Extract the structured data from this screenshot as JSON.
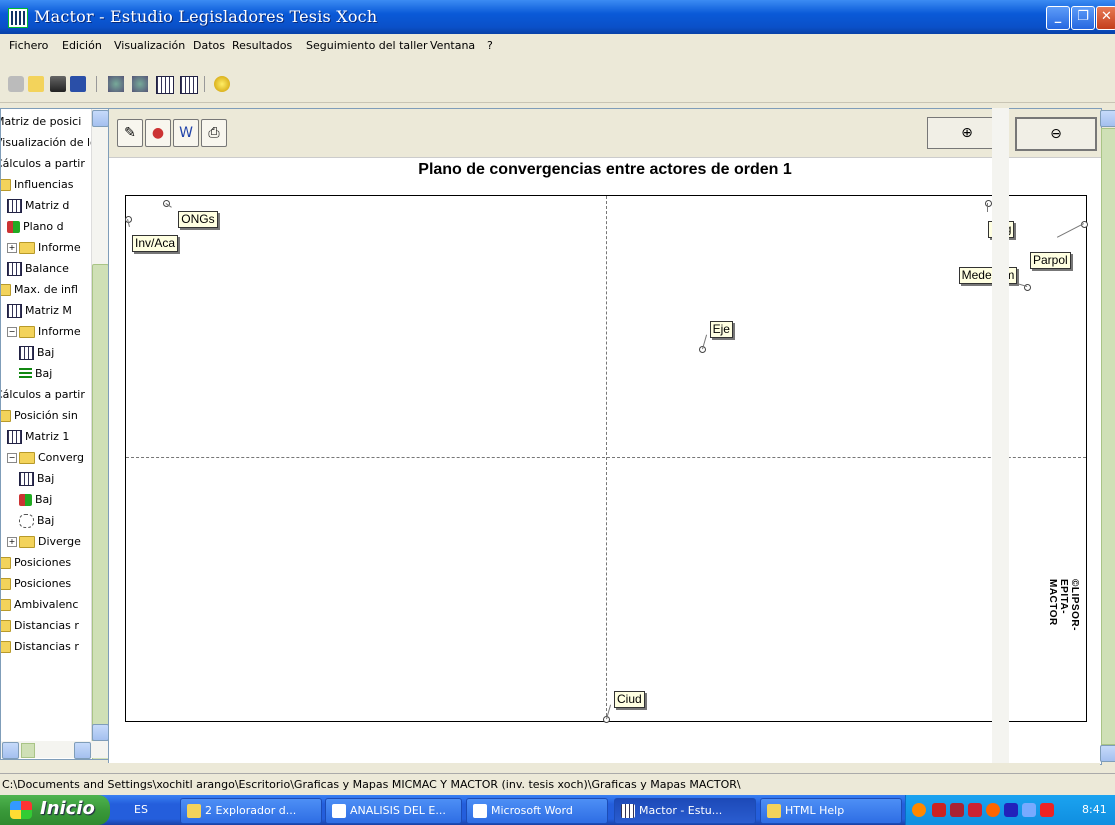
{
  "window": {
    "app": "Mactor",
    "separator": "-",
    "study": "Estudio Legisladores Tesis Xoch",
    "buttons": {
      "minimize": "_",
      "restore": "❐",
      "close": "✕"
    }
  },
  "menu": [
    "Fichero",
    "Edición",
    "Visualización",
    "Datos",
    "Resultados",
    "Seguimiento del taller",
    "Ventana",
    "?"
  ],
  "toolbar_icons": [
    "new-icon",
    "open-icon",
    "print-icon",
    "save-icon",
    "wizard-icon",
    "wizard2-icon",
    "table-icon",
    "table2-icon",
    "help-icon"
  ],
  "tree": {
    "items": [
      {
        "label": "Matriz de posici",
        "icon": "none",
        "indent": 0
      },
      {
        "label": "Visualización de los",
        "icon": "none",
        "indent": 0
      },
      {
        "label": "Cálculos a partir",
        "icon": "none",
        "indent": 0
      },
      {
        "label": "Influencias",
        "icon": "folder",
        "indent": 0
      },
      {
        "label": "Matriz d",
        "icon": "grid",
        "indent": 1
      },
      {
        "label": "Plano d",
        "icon": "plane",
        "indent": 1
      },
      {
        "label": "Informe",
        "icon": "folder",
        "indent": 1,
        "expander": "+"
      },
      {
        "label": "Balance",
        "icon": "grid",
        "indent": 1
      },
      {
        "label": "Max. de infl",
        "icon": "folder",
        "indent": 0
      },
      {
        "label": "Matriz M",
        "icon": "grid",
        "indent": 1
      },
      {
        "label": "Informe",
        "icon": "folder",
        "indent": 1,
        "expander": "−"
      },
      {
        "label": "Baj",
        "icon": "grid",
        "indent": 2
      },
      {
        "label": "Baj",
        "icon": "bars",
        "indent": 2
      },
      {
        "label": "Cálculos a partir",
        "icon": "none",
        "indent": 0
      },
      {
        "label": "Posición sin",
        "icon": "folder",
        "indent": 0
      },
      {
        "label": "Matriz 1",
        "icon": "grid",
        "indent": 1
      },
      {
        "label": "Converg",
        "icon": "folder",
        "indent": 1,
        "expander": "−"
      },
      {
        "label": "Baj",
        "icon": "grid",
        "indent": 2
      },
      {
        "label": "Baj",
        "icon": "plane",
        "indent": 2
      },
      {
        "label": "Baj",
        "icon": "net",
        "indent": 2
      },
      {
        "label": "Diverge",
        "icon": "folder",
        "indent": 1,
        "expander": "+"
      },
      {
        "label": "Posiciones",
        "icon": "folder",
        "indent": 0
      },
      {
        "label": "Posiciones",
        "icon": "folder",
        "indent": 0
      },
      {
        "label": "Ambivalenc",
        "icon": "folder",
        "indent": 0
      },
      {
        "label": "Distancias r",
        "icon": "folder",
        "indent": 0
      },
      {
        "label": "Distancias r",
        "icon": "folder",
        "indent": 0
      }
    ]
  },
  "main_toolbar": {
    "left_icons": [
      "copy-icon",
      "color-icon",
      "word-export-icon",
      "print-icon"
    ],
    "zoom_in": "⊕",
    "zoom_out": "⊖"
  },
  "chart_data": {
    "type": "scatter",
    "title": "Plano de convergencias entre actores de orden 1",
    "grid": "quadrant-dashed",
    "points": [
      {
        "name": "ONGs",
        "x": 0.04,
        "y": 0.99
      },
      {
        "name": "Inv/Aca",
        "x": 0.0,
        "y": 0.96
      },
      {
        "name": "Leg",
        "x": 0.9,
        "y": 0.99
      },
      {
        "name": "Parpol",
        "x": 1.0,
        "y": 0.95
      },
      {
        "name": "Medecom",
        "x": 0.94,
        "y": 0.83
      },
      {
        "name": "Eje",
        "x": 0.6,
        "y": 0.71
      },
      {
        "name": "Ciud",
        "x": 0.5,
        "y": 0.0
      }
    ],
    "watermark": "©LIPSOR-EPITA-MACTOR"
  },
  "status": "C:\\Documents and Settings\\xochitl arango\\Escritorio\\Graficas y Mapas MICMAC Y MACTOR (inv. tesis xoch)\\Graficas y Mapas MACTOR\\",
  "taskbar": {
    "start": "Inicio",
    "lang": "ES",
    "tasks": [
      {
        "label": "2 Explorador d...",
        "icon_color": "#F3D35B",
        "active": false
      },
      {
        "label": "ANALISIS DEL E...",
        "icon_color": "#ffffff",
        "active": false
      },
      {
        "label": "Microsoft Word",
        "icon_color": "#ffffff",
        "active": false
      },
      {
        "label": "Mactor  -  Estu...",
        "icon_color": "#ffffff",
        "active": true
      },
      {
        "label": "HTML Help",
        "icon_color": "#F3D35B",
        "active": false
      }
    ],
    "clock": "8:41"
  }
}
